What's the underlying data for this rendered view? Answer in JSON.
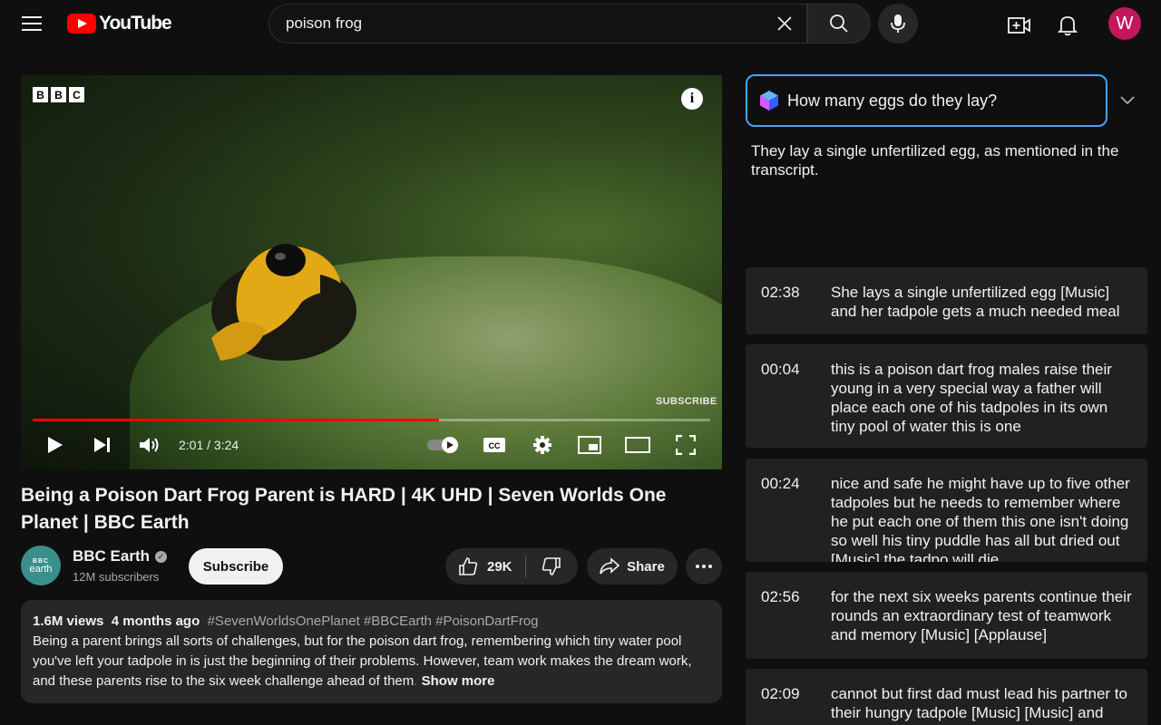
{
  "header": {
    "logo_text": "YouTube",
    "search_value": "poison frog",
    "avatar_letter": "W"
  },
  "player": {
    "channel_watermark": [
      "B",
      "B",
      "C"
    ],
    "subscribe_watermark": "SUBSCRIBE",
    "time": "2:01 / 3:24",
    "progress_fraction": 0.6
  },
  "video": {
    "title": "Being a Poison Dart Frog Parent is HARD | 4K UHD | Seven Worlds One Planet | BBC Earth",
    "channel": {
      "name": "BBC Earth",
      "subscribers": "12M subscribers",
      "avatar_top": "BBC",
      "avatar_bottom": "earth"
    },
    "subscribe_label": "Subscribe",
    "likes": "29K",
    "share_label": "Share",
    "description": {
      "views": "1.6M views",
      "age": "4 months ago",
      "tags": "#SevenWorldsOnePlanet #BBCEarth #PoisonDartFrog",
      "text": "Being a parent brings all sorts of challenges, but for the poison dart frog, remembering which tiny water pool you've left your tadpole in is just the beginning of their problems. However, team work makes the dream work, and these parents rise to the six week challenge ahead of them",
      "fade": ".",
      "show_more": "Show more"
    }
  },
  "assistant": {
    "question": "How many eggs do they lay?",
    "answer": "They lay a single unfertilized egg, as mentioned in the transcript."
  },
  "transcript": [
    {
      "time": "02:38",
      "text": "She lays a single unfertilized egg [Music] and her tadpole gets a much needed meal"
    },
    {
      "time": "00:04",
      "text": "this is a poison dart frog males raise their young in a very special way a father will place each one of his tadpoles in its own tiny pool of water this is one"
    },
    {
      "time": "00:24",
      "text": "nice and safe he might have up to five other tadpoles but he needs to remember where he put each one of them this one isn't doing so well his tiny puddle has all but dried out [Music] the tadpo will die"
    },
    {
      "time": "02:56",
      "text": "for the next six weeks parents continue their rounds an extraordinary test of teamwork and memory [Music] [Applause]"
    },
    {
      "time": "02:09",
      "text": "cannot but first dad must lead his partner to their hungry tadpole [Music] [Music] and"
    }
  ]
}
